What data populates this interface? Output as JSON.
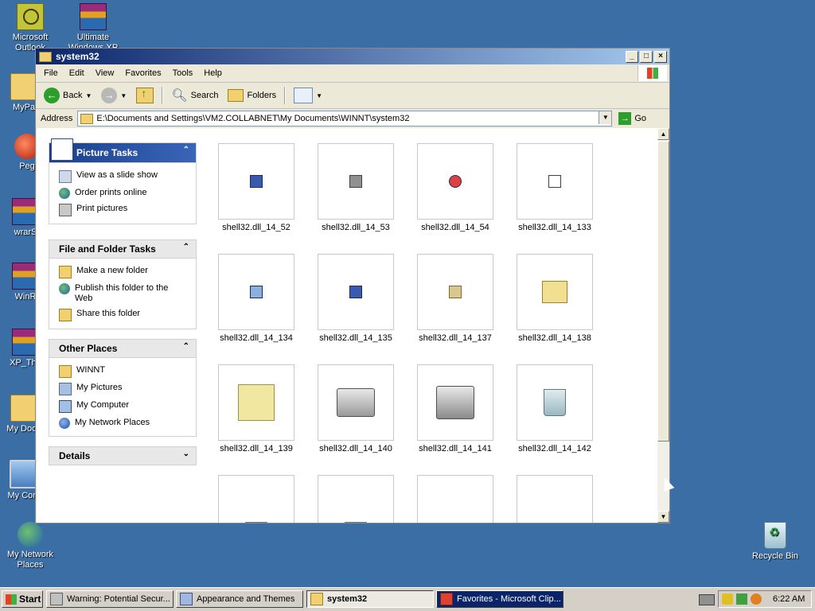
{
  "desktop": {
    "icons": [
      {
        "label": "Microsoft\nOutlook"
      },
      {
        "label": "Ultimate\nWindows XP"
      },
      {
        "label": "MyPa"
      },
      {
        "label": "Peg"
      },
      {
        "label": "wrarS"
      },
      {
        "label": "WinR"
      },
      {
        "label": "XP_The"
      },
      {
        "label": "My Docu"
      },
      {
        "label": "My Com"
      },
      {
        "label": "My Network\nPlaces"
      },
      {
        "label": "Recycle Bin"
      }
    ]
  },
  "window": {
    "title": "system32",
    "menu": [
      "File",
      "Edit",
      "View",
      "Favorites",
      "Tools",
      "Help"
    ],
    "toolbar": {
      "back": "Back",
      "search": "Search",
      "folders": "Folders"
    },
    "address": {
      "label": "Address",
      "value": "E:\\Documents and Settings\\VM2.COLLABNET\\My Documents\\WINNT\\system32",
      "go": "Go"
    }
  },
  "tasks": {
    "picture": {
      "title": "Picture Tasks",
      "items": [
        "View as a slide show",
        "Order prints online",
        "Print pictures"
      ]
    },
    "file": {
      "title": "File and Folder Tasks",
      "items": [
        "Make a new folder",
        "Publish this folder to the Web",
        "Share this folder"
      ]
    },
    "places": {
      "title": "Other Places",
      "items": [
        "WINNT",
        "My Pictures",
        "My Computer",
        "My Network Places"
      ]
    },
    "details": {
      "title": "Details"
    }
  },
  "files": [
    "shell32.dll_14_52",
    "shell32.dll_14_53",
    "shell32.dll_14_54",
    "shell32.dll_14_133",
    "shell32.dll_14_134",
    "shell32.dll_14_135",
    "shell32.dll_14_137",
    "shell32.dll_14_138",
    "shell32.dll_14_139",
    "shell32.dll_14_140",
    "shell32.dll_14_141",
    "shell32.dll_14_142",
    "",
    "",
    "",
    ""
  ],
  "taskbar": {
    "start": "Start",
    "tasks": [
      "Warning: Potential Secur...",
      "Appearance and Themes",
      "system32",
      "Favorites - Microsoft Clip..."
    ],
    "clock": "6:22 AM"
  }
}
